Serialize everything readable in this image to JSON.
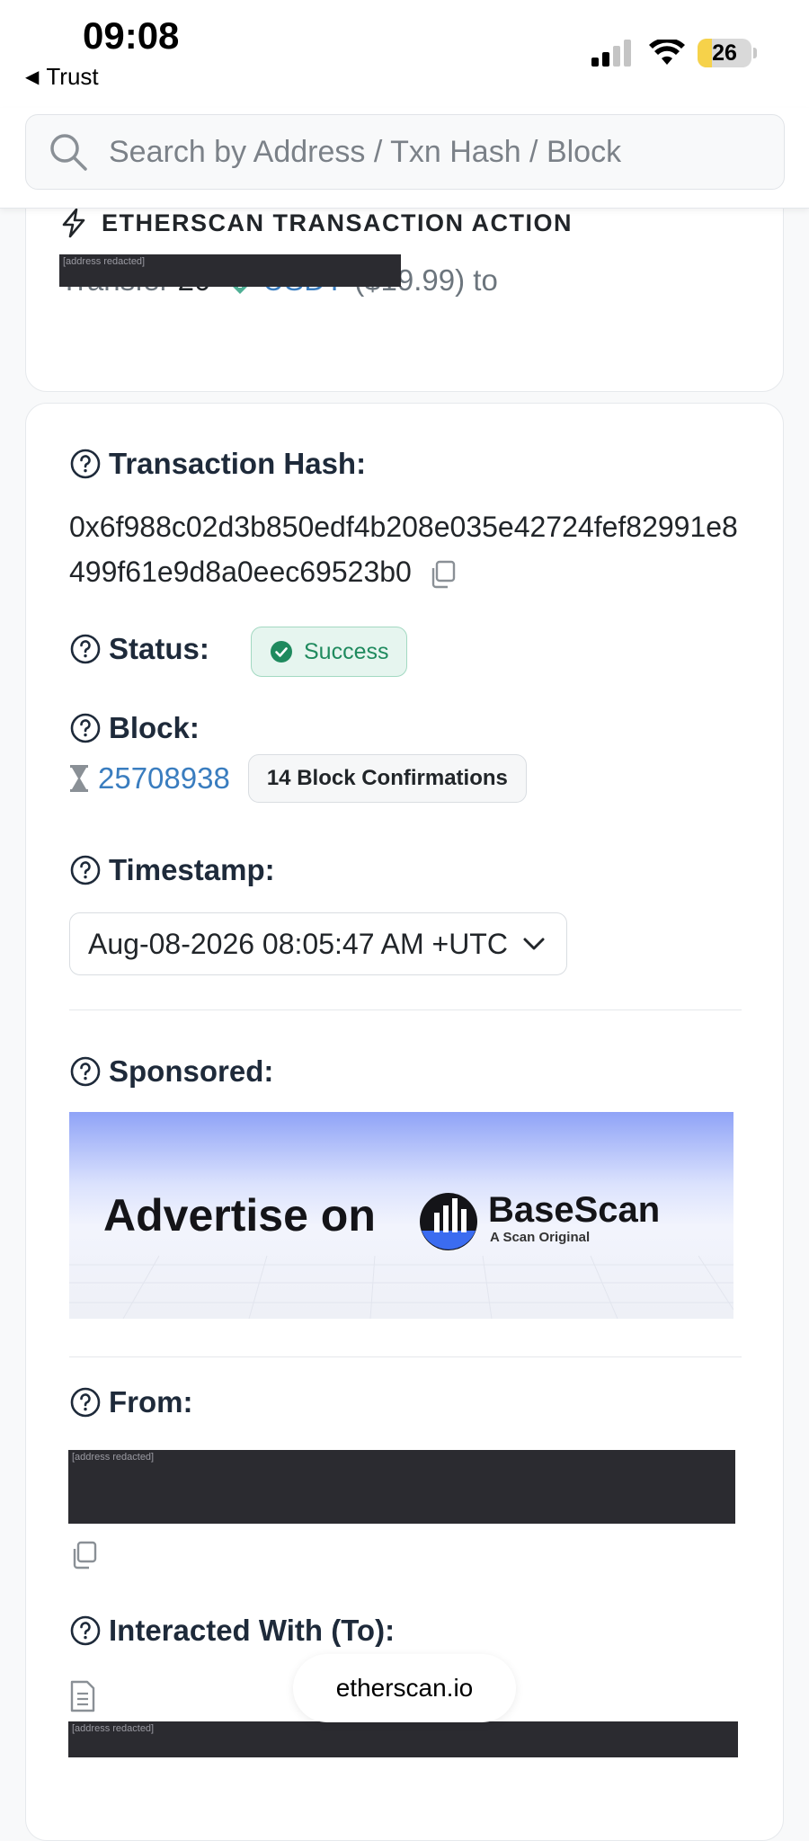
{
  "status_bar": {
    "time": "09:08",
    "back_app": "Trust",
    "battery_level": 26,
    "battery_text": "26"
  },
  "search": {
    "placeholder": "Search by Address / Txn Hash / Block"
  },
  "action": {
    "title": "ETHERSCAN TRANSACTION ACTION",
    "transfer_word": "Transfer",
    "amount": "20",
    "token": "USDT",
    "usd_value": "($19.99) to",
    "redacted_label": "[address redacted]"
  },
  "details": {
    "tx_hash_label": "Transaction Hash:",
    "tx_hash_value": "0x6f988c02d3b850edf4b208e035e42724fef82991e8499f61e9d8a0eec69523b0",
    "status_label": "Status:",
    "status_value": "Success",
    "block_label": "Block:",
    "block_value": "25708938",
    "block_confirmations": "14 Block Confirmations",
    "timestamp_label": "Timestamp:",
    "timestamp_value": "Aug-08-2026 08:05:47 AM +UTC",
    "sponsored_label": "Sponsored:",
    "ad_text": "Advertise on",
    "ad_brand": "BaseScan",
    "ad_tagline": "A Scan Original",
    "from_label": "From:",
    "from_redacted": "[address redacted]",
    "to_label": "Interacted With (To):",
    "to_redacted": "[address redacted]"
  },
  "browser": {
    "url": "etherscan.io"
  },
  "colors": {
    "link": "#3a7dbf",
    "success": "#1f8a5e",
    "success_bg": "#e6f5ef",
    "tether": "#50af95"
  }
}
